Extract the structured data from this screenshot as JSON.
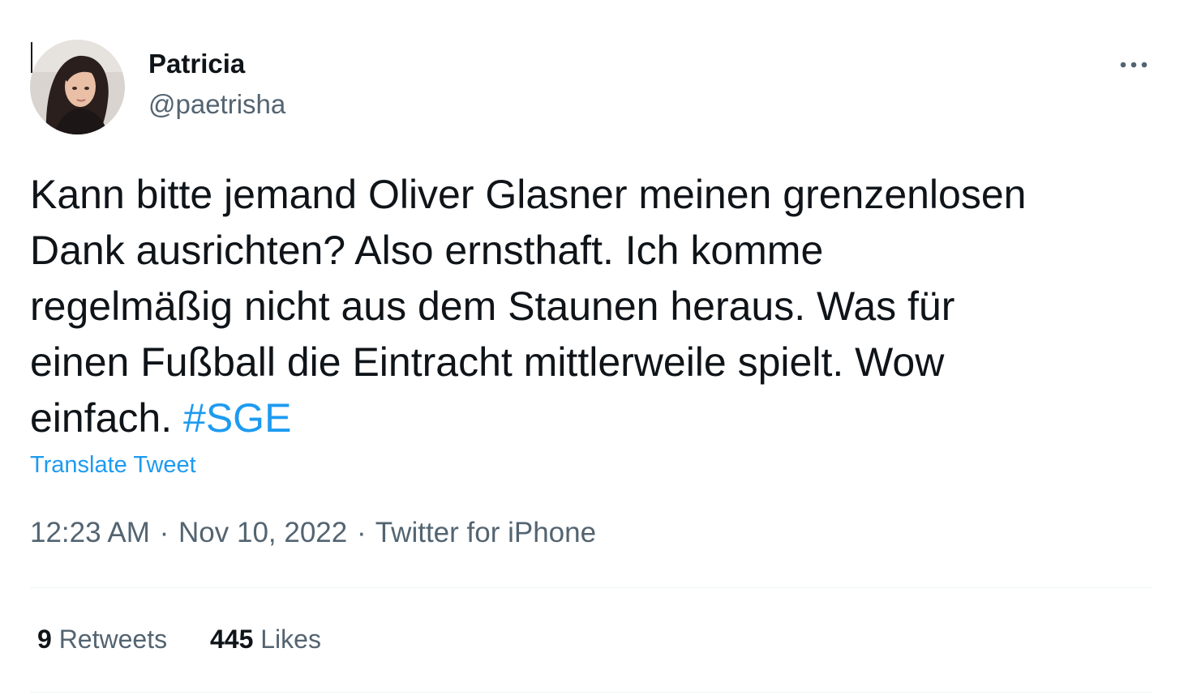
{
  "user": {
    "display_name": "Patricia",
    "handle": "@paetrisha",
    "avatar_icon": "profile-photo"
  },
  "tweet": {
    "text_lines": [
      "Kann bitte jemand Oliver Glasner meinen grenzenlosen",
      "Dank ausrichten?  Also ernsthaft. Ich komme",
      "regelmäßig nicht aus dem Staunen heraus. Was für",
      "einen Fußball die Eintracht mittlerweile spielt. Wow",
      "einfach. "
    ],
    "hashtag": "#SGE",
    "translate_label": "Translate Tweet"
  },
  "meta": {
    "time": "12:23 AM",
    "separator": "·",
    "date": "Nov 10, 2022",
    "source": "Twitter for iPhone"
  },
  "stats": {
    "retweets_count": "9",
    "retweets_label": "Retweets",
    "likes_count": "445",
    "likes_label": "Likes"
  },
  "colors": {
    "link": "#1d9bf0",
    "secondary_text": "#536471",
    "primary_text": "#0f1419",
    "divider": "#eff3f4"
  },
  "icons": {
    "more": "more-horizontal-icon"
  }
}
